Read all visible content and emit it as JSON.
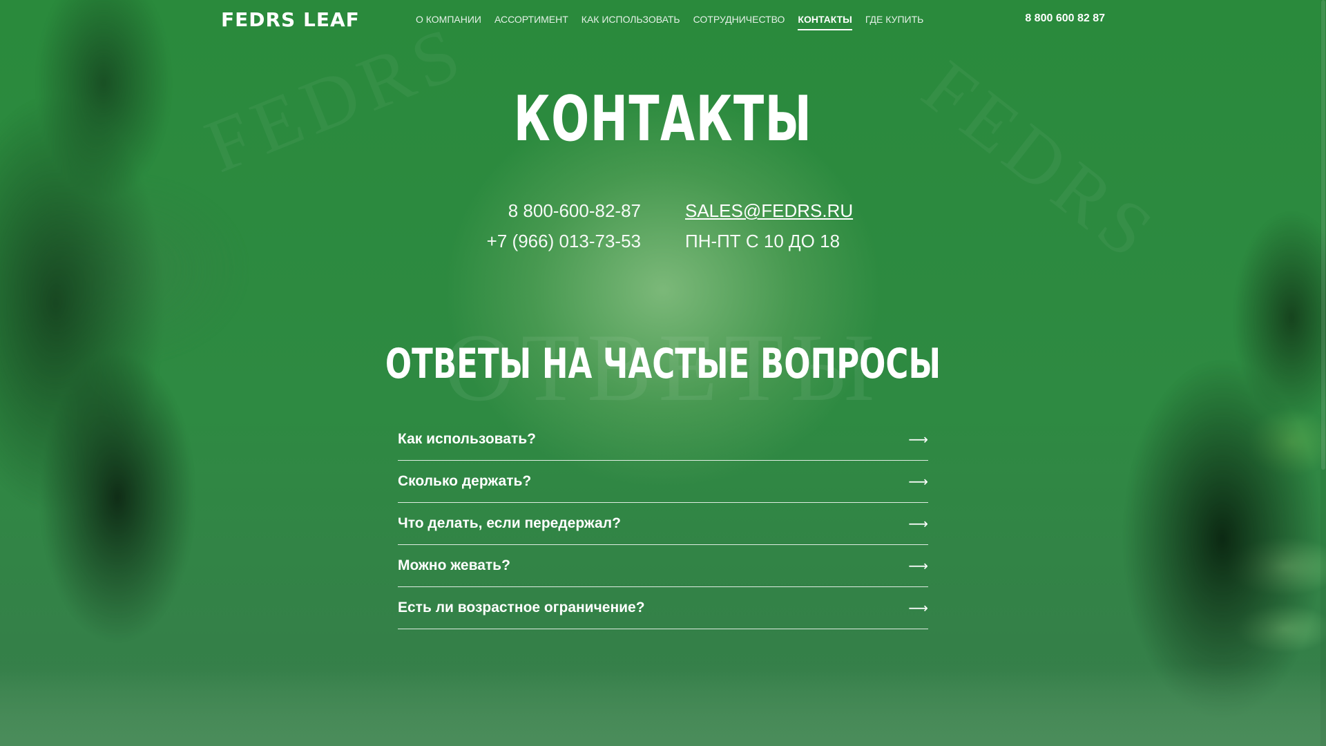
{
  "header": {
    "logo": "FEDRS LEAF",
    "nav": [
      {
        "label": "О КОМПАНИИ"
      },
      {
        "label": "АССОРТИМЕНТ"
      },
      {
        "label": "КАК ИСПОЛЬЗОВАТЬ"
      },
      {
        "label": "СОТРУДНИЧЕСТВО"
      },
      {
        "label": "КОНТАКТЫ",
        "active": true
      },
      {
        "label": "ГДЕ КУПИТЬ"
      }
    ],
    "phone": "8 800 600 82 87"
  },
  "background": {
    "watermarks": [
      "FEDRS",
      "FEDRS",
      "ОТВЕТЫ"
    ]
  },
  "main": {
    "title": "КОНТАКТЫ",
    "contacts": {
      "phone_1": "8 800-600-82-87",
      "phone_2": "+7 (966) 013-73-53",
      "email": "SALES@FEDRS.RU",
      "hours": "ПН-ПТ С 10 ДО 18"
    },
    "faq": {
      "title": "ОТВЕТЫ НА ЧАСТЫЕ ВОПРОСЫ",
      "arrow_icon": "arrow-right-icon",
      "items": [
        {
          "question": "Как использовать?"
        },
        {
          "question": "Сколько держать?"
        },
        {
          "question": "Что делать, если передержал?"
        },
        {
          "question": "Можно жевать?"
        },
        {
          "question": "Есть ли возрастное ограничение?"
        }
      ]
    }
  },
  "colors": {
    "background": "#2f8a41",
    "text": "#ffffff"
  }
}
